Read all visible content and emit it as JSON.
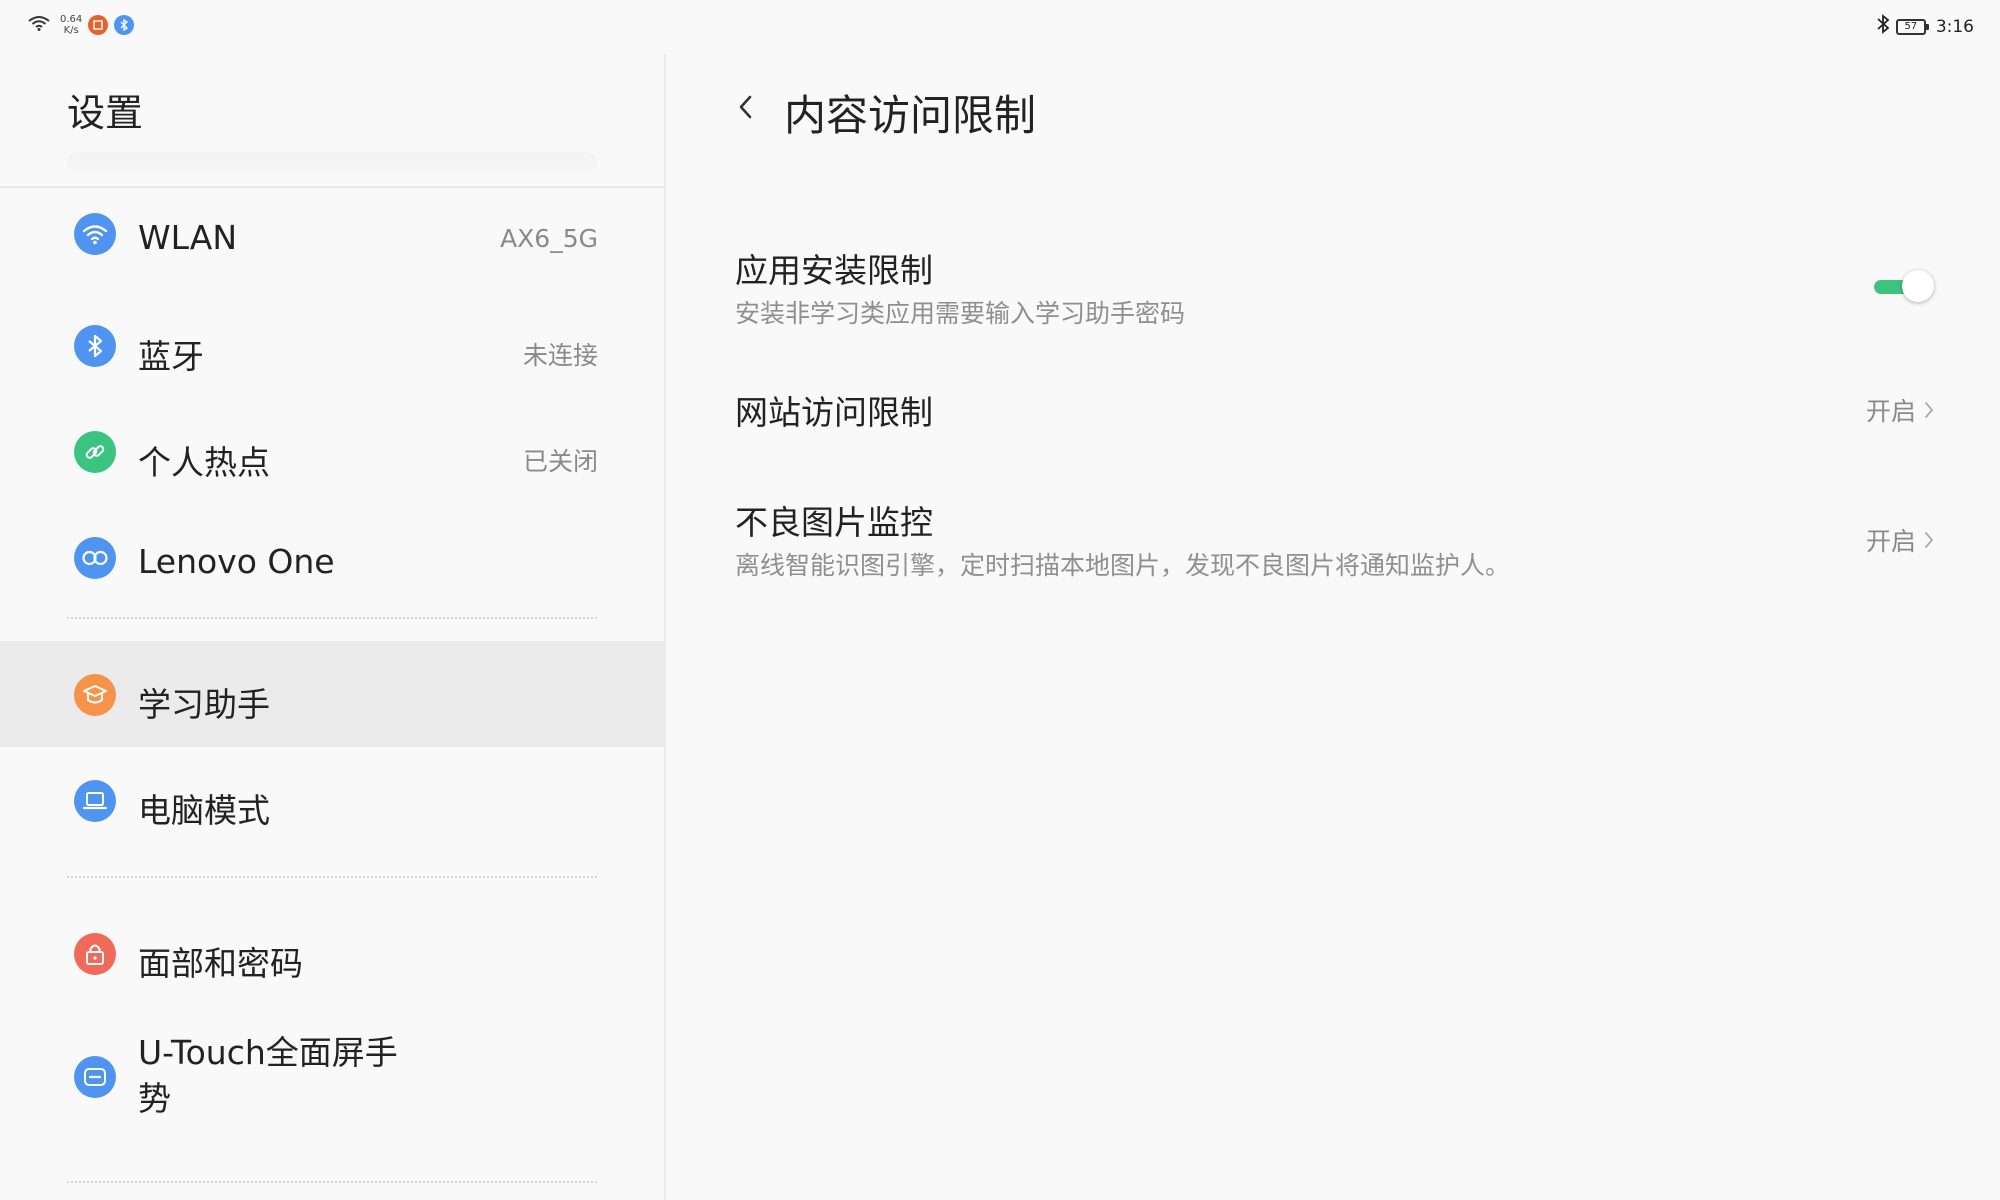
{
  "status_bar": {
    "net_speed_value": "0.64",
    "net_speed_unit": "K/s",
    "battery": "57",
    "time": "3:16",
    "icons": [
      "wifi-icon",
      "app-notification-icon",
      "bluetooth-notification-icon",
      "bluetooth-icon",
      "battery-icon"
    ]
  },
  "left": {
    "title": "设置",
    "items": [
      {
        "label": "WLAN",
        "value": "AX6_5G",
        "icon": "wifi-icon",
        "color": "#4f94f0"
      },
      {
        "label": "蓝牙",
        "value": "未连接",
        "icon": "bluetooth-icon",
        "color": "#4f94f0"
      },
      {
        "label": "个人热点",
        "value": "已关闭",
        "icon": "hotspot-link-icon",
        "color": "#3cc37f"
      },
      {
        "label": "Lenovo One",
        "value": "",
        "icon": "lenovo-one-icon",
        "color": "#4f94f0"
      },
      {
        "label": "学习助手",
        "value": "",
        "icon": "graduation-cap-icon",
        "color": "#f59349",
        "active": true
      },
      {
        "label": "电脑模式",
        "value": "",
        "icon": "laptop-icon",
        "color": "#4f94f0"
      },
      {
        "label": "面部和密码",
        "value": "",
        "icon": "lock-icon",
        "color": "#f06a5a"
      },
      {
        "label": "U-Touch全面屏手势",
        "label_line1": "U-Touch全面屏手",
        "label_line2": "势",
        "value": "",
        "icon": "gesture-icon",
        "color": "#4f94f0"
      }
    ]
  },
  "right": {
    "title": "内容访问限制",
    "back_icon": "chevron-left-icon",
    "settings": [
      {
        "title": "应用安装限制",
        "desc": "安装非学习类应用需要输入学习助手密码",
        "control": "toggle",
        "enabled": true
      },
      {
        "title": "网站访问限制",
        "desc": "",
        "control": "link",
        "status": "开启"
      },
      {
        "title": "不良图片监控",
        "desc": "离线智能识图引擎，定时扫描本地图片，发现不良图片将通知监护人。",
        "control": "link",
        "status": "开启"
      }
    ]
  },
  "colors": {
    "accent_blue": "#4f94f0",
    "accent_green": "#3cc37f",
    "accent_orange": "#f59349",
    "accent_red": "#f06a5a",
    "background": "#f9f9f9",
    "active_row": "#ebebeb"
  }
}
